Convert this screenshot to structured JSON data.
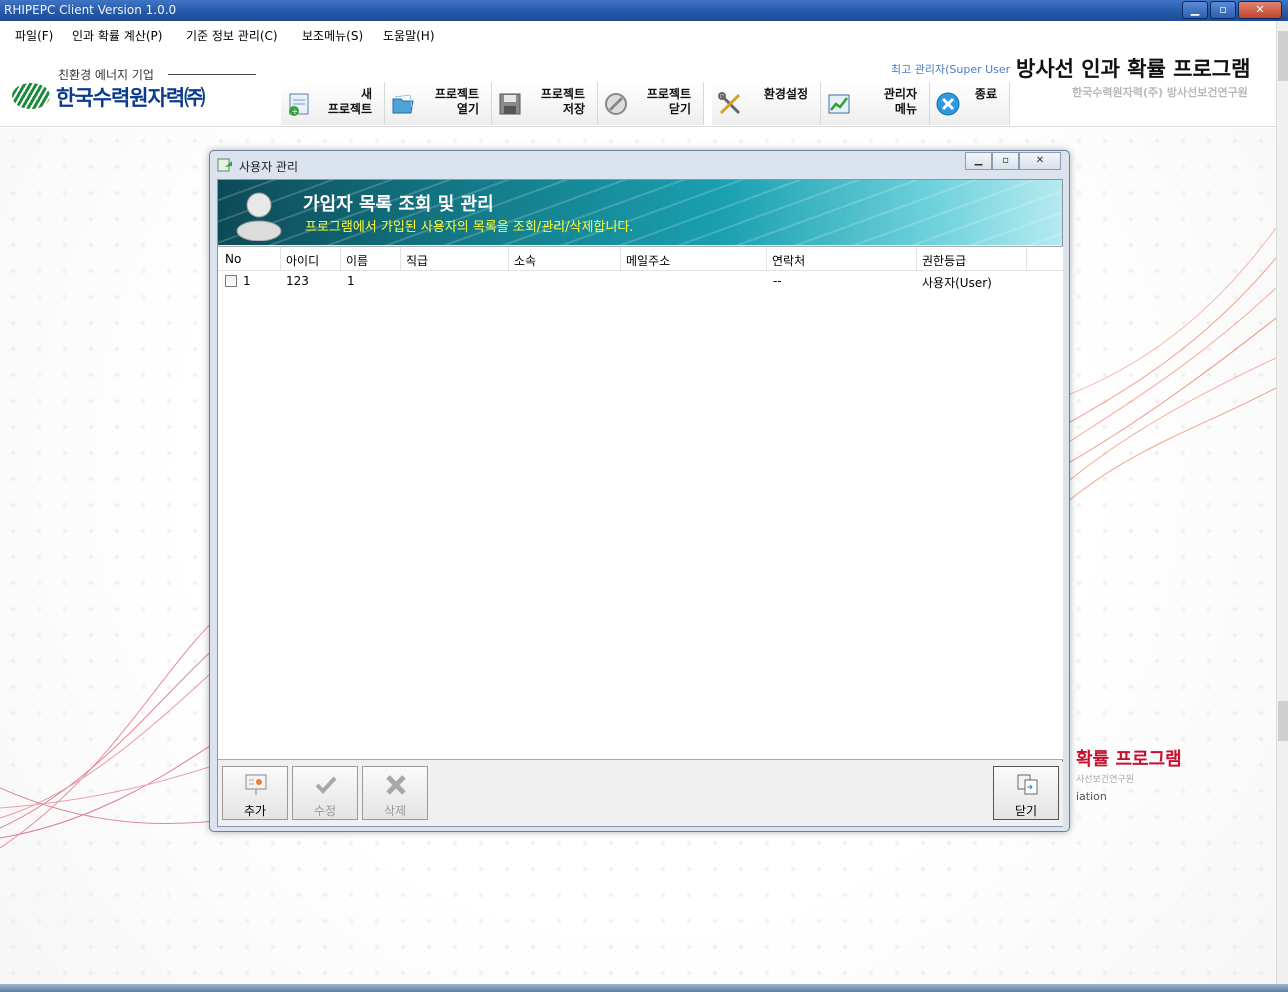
{
  "window": {
    "title": "RHIPEPC Client Version 1.0.0",
    "min": "▁",
    "max": "▫",
    "close": "✕"
  },
  "menubar": [
    "파일(F)",
    "인과 확률 계산(P)",
    "기준 정보 관리(C)",
    "보조메뉴(S)",
    "도움말(H)"
  ],
  "header": {
    "logo_sub": "친환경 에너지 기업",
    "logo_text": "한국수력원자력㈜",
    "super_user": "최고 관리자(Super User",
    "app_title": "방사선 인과 확률 프로그램",
    "app_sub": "한국수력원자력(주) 방사선보건연구원"
  },
  "toolbar": [
    {
      "label": "새\n프로젝트",
      "icon": "new-project-icon"
    },
    {
      "label": "프로젝트\n열기",
      "icon": "open-folder-icon"
    },
    {
      "label": "프로젝트\n저장",
      "icon": "save-disk-icon"
    },
    {
      "label": "프로젝트\n닫기",
      "icon": "close-circle-icon"
    },
    {
      "label": "환경설정",
      "icon": "tools-icon"
    },
    {
      "label": "관리자\n메뉴",
      "icon": "chart-icon"
    },
    {
      "label": "종료",
      "icon": "exit-icon"
    }
  ],
  "background": {
    "title": "확률 프로그램",
    "sub": "사선보건연구원",
    "sub2": "iation"
  },
  "dialog": {
    "title": "사용자 관리",
    "banner_title": "가입자 목록 조회 및 관리",
    "banner_sub": "프로그램에서 가입된 사용자의 목록을 조회/관리/삭제합니다.",
    "columns": [
      "No",
      "아이디",
      "이름",
      "직급",
      "소속",
      "메일주소",
      "연락처",
      "권한등급"
    ],
    "rows": [
      {
        "no": "1",
        "id": "123",
        "name": "1",
        "rank": "",
        "dept": "",
        "email": "",
        "phone": "--",
        "role": "사용자(User)",
        "checked": false
      }
    ],
    "buttons": {
      "add": "추가",
      "edit": "수정",
      "delete": "삭제",
      "close": "닫기"
    }
  },
  "colors": {
    "titlebar": "#2458a6",
    "banner": "#137a88",
    "banner_sub": "#ffff3a",
    "accent_red": "#c8102e"
  }
}
